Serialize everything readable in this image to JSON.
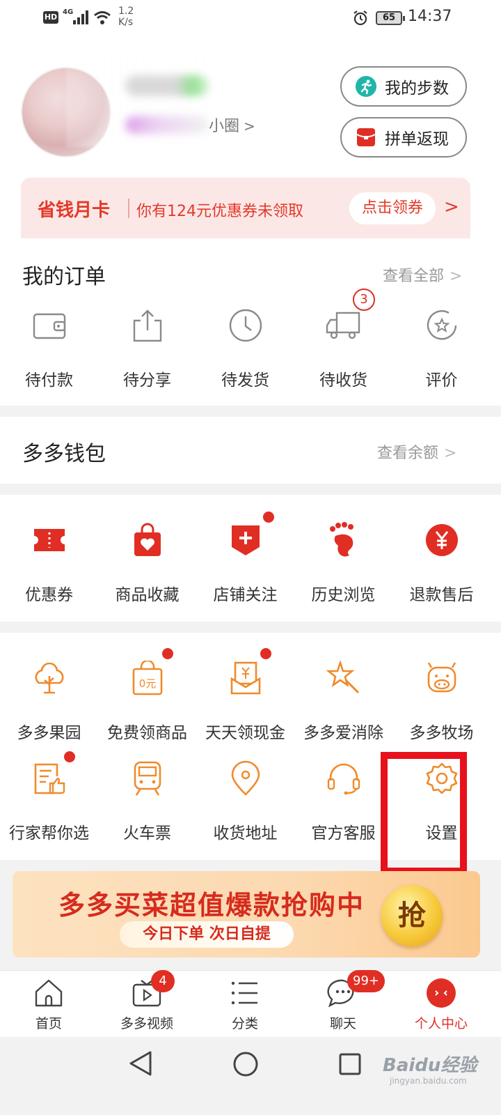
{
  "status_bar": {
    "hd": "HD",
    "network": "4G",
    "speed": "1.2 K/s",
    "battery": "65",
    "time": "14:37"
  },
  "header": {
    "circle_link": "小圈",
    "steps_button": "我的步数",
    "group_button": "拼单返现"
  },
  "save_card": {
    "title": "省钱月卡",
    "text": "你有124元优惠券未领取",
    "button": "点击领券"
  },
  "orders": {
    "title": "我的订单",
    "view_all": "查看全部",
    "items": [
      {
        "label": "待付款",
        "icon": "wallet-icon"
      },
      {
        "label": "待分享",
        "icon": "share-icon"
      },
      {
        "label": "待发货",
        "icon": "clock-icon"
      },
      {
        "label": "待收货",
        "icon": "truck-icon",
        "badge": "3"
      },
      {
        "label": "评价",
        "icon": "review-icon"
      }
    ]
  },
  "wallet": {
    "title": "多多钱包",
    "link": "查看余额"
  },
  "tools1": [
    {
      "label": "优惠券",
      "icon": "coupon-icon"
    },
    {
      "label": "商品收藏",
      "icon": "favorites-icon"
    },
    {
      "label": "店铺关注",
      "icon": "store-follow-icon"
    },
    {
      "label": "历史浏览",
      "icon": "footprint-icon"
    },
    {
      "label": "退款售后",
      "icon": "refund-icon"
    }
  ],
  "tools2": [
    {
      "label": "多多果园",
      "icon": "tree-icon"
    },
    {
      "label": "免费领商品",
      "icon": "free-bag-icon"
    },
    {
      "label": "天天领现金",
      "icon": "cash-icon"
    },
    {
      "label": "多多爱消除",
      "icon": "star-wand-icon"
    },
    {
      "label": "多多牧场",
      "icon": "cow-icon"
    },
    {
      "label": "行家帮你选",
      "icon": "thumbs-up-icon"
    },
    {
      "label": "火车票",
      "icon": "train-icon"
    },
    {
      "label": "收货地址",
      "icon": "location-icon"
    },
    {
      "label": "官方客服",
      "icon": "headset-icon"
    },
    {
      "label": "设置",
      "icon": "gear-icon"
    }
  ],
  "banner": {
    "title": "多多买菜超值爆款抢购中",
    "subtitle": "今日下单 次日自提",
    "badge": "抢"
  },
  "tabbar": [
    {
      "label": "首页",
      "icon": "home-icon"
    },
    {
      "label": "多多视频",
      "icon": "video-icon",
      "badge": "4"
    },
    {
      "label": "分类",
      "icon": "category-icon"
    },
    {
      "label": "聊天",
      "icon": "chat-icon",
      "badge": "99+"
    },
    {
      "label": "个人中心",
      "icon": "profile-icon",
      "active": true
    }
  ],
  "watermark": {
    "text": "Baidu经验",
    "sub": "jingyan.baidu.com"
  },
  "colors": {
    "accent": "#e02e24",
    "orange": "#f08a2a",
    "gray_icon": "#8a8a8a"
  }
}
